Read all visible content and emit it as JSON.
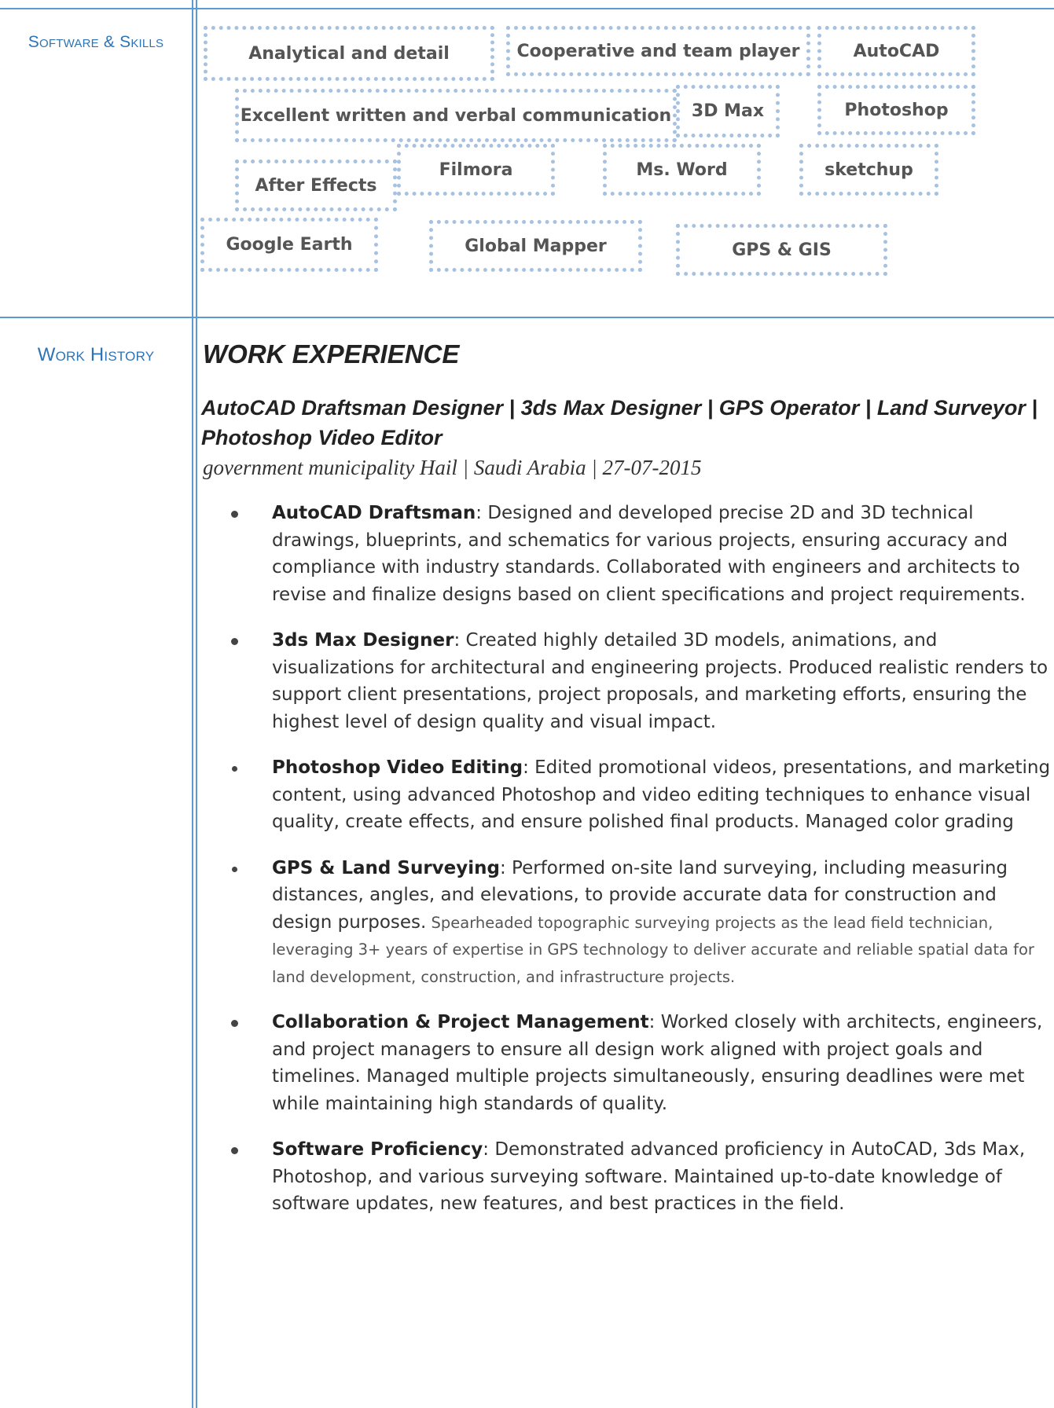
{
  "sections": {
    "skills_label": "Software & Skills",
    "work_label": "Work History"
  },
  "skills": [
    "Analytical and detail",
    "Cooperative and team player",
    "AutoCAD",
    "Excellent written and verbal communication",
    "3D Max",
    "Photoshop",
    "After Effects",
    "Filmora",
    "Ms. Word",
    "sketchup",
    "Google Earth",
    "Global Mapper",
    "GPS & GIS"
  ],
  "work": {
    "heading": "WORK EXPERIENCE",
    "job_title": "AutoCAD Draftsman Designer | 3ds Max Designer | GPS Operator | Land Surveyor | Photoshop Video Editor",
    "job_meta": "government municipality Hail | Saudi Arabia | 27-07-2015",
    "bullets": [
      {
        "title": "AutoCAD Draftsman",
        "text": ": Designed and developed precise 2D and 3D technical drawings, blueprints, and schematics for various projects, ensuring accuracy and compliance with industry standards. Collaborated with engineers and architects to revise and finalize designs based on client specifications and project requirements.",
        "extra": ""
      },
      {
        "title": "3ds Max Designer",
        "text": ": Created highly detailed 3D models, animations, and visualizations for architectural and engineering projects. Produced realistic renders to support client presentations, project proposals, and marketing efforts, ensuring the highest level of design quality and visual impact.",
        "extra": ""
      },
      {
        "title": "Photoshop Video Editing",
        "text": ": Edited promotional videos, presentations, and marketing content, using advanced Photoshop and video editing techniques to enhance visual quality, create effects, and ensure polished final products. Managed color grading",
        "extra": ""
      },
      {
        "title": "GPS & Land Surveying",
        "text": ": Performed on-site land surveying, including measuring distances, angles, and elevations, to provide accurate data for construction and design purposes.",
        "extra": " Spearheaded topographic surveying projects as the lead field technician, leveraging 3+ years of expertise in GPS technology to deliver accurate and reliable spatial data for land development, construction, and infrastructure projects."
      },
      {
        "title": "Collaboration & Project Management",
        "text": ": Worked closely with architects, engineers, and project managers to ensure all design work aligned with project goals and timelines. Managed multiple projects simultaneously, ensuring deadlines were met while maintaining high standards of quality.",
        "extra": ""
      },
      {
        "title": "Software Proficiency",
        "text": ": Demonstrated advanced proficiency in AutoCAD, 3ds Max, Photoshop, and various surveying software. Maintained up-to-date knowledge of software updates, new features, and best practices in the field.",
        "extra": ""
      }
    ]
  }
}
